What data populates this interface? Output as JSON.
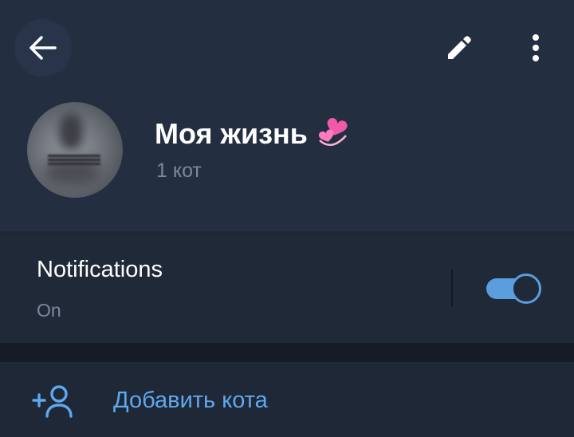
{
  "header": {
    "chat_title": "Моя жизнь",
    "title_emoji": "revolving-hearts-emoji",
    "subtitle": "1 кот",
    "back_icon": "arrow-left-icon",
    "edit_icon": "pencil-icon",
    "more_icon": "more-vertical-icon"
  },
  "notifications": {
    "label": "Notifications",
    "status": "On",
    "enabled": true
  },
  "actions": {
    "add_member_label": "Добавить кота",
    "add_member_icon": "add-user-icon"
  },
  "colors": {
    "accent": "#5fa8ee",
    "header_bg": "#232f40",
    "background": "#1d2733",
    "muted_text": "#7a8a9c"
  }
}
